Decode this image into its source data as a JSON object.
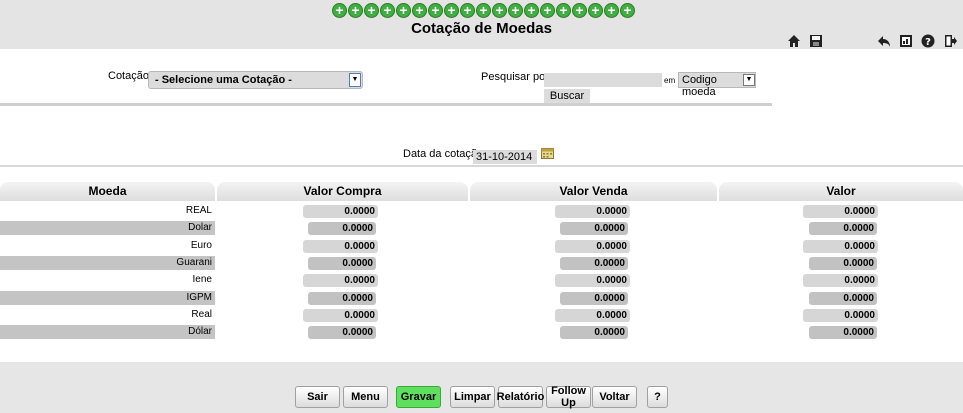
{
  "header": {
    "title": "Cotação de Moedas",
    "plus_count": 19
  },
  "filters": {
    "cotacao_label": "Cotação",
    "cotacao_value": "- Selecione uma Cotação -",
    "search_label": "Pesquisar por:",
    "em_label": "em",
    "search_field_value": "Codigo moeda",
    "buscar_label": "Buscar",
    "date_label": "Data da cotação",
    "date_value": "31-10-2014"
  },
  "table": {
    "headers": [
      "Moeda",
      "Valor Compra",
      "Valor Venda",
      "Valor"
    ],
    "rows": [
      {
        "moeda": "REAL",
        "compra": "0.0000",
        "venda": "0.0000",
        "valor": "0.0000"
      },
      {
        "moeda": "Dolar",
        "compra": "0.0000",
        "venda": "0.0000",
        "valor": "0.0000"
      },
      {
        "moeda": "Euro",
        "compra": "0.0000",
        "venda": "0.0000",
        "valor": "0.0000"
      },
      {
        "moeda": "Guarani",
        "compra": "0.0000",
        "venda": "0.0000",
        "valor": "0.0000"
      },
      {
        "moeda": "Iene",
        "compra": "0.0000",
        "venda": "0.0000",
        "valor": "0.0000"
      },
      {
        "moeda": "IGPM",
        "compra": "0.0000",
        "venda": "0.0000",
        "valor": "0.0000"
      },
      {
        "moeda": "Real",
        "compra": "0.0000",
        "venda": "0.0000",
        "valor": "0.0000"
      },
      {
        "moeda": "Dólar",
        "compra": "0.0000",
        "venda": "0.0000",
        "valor": "0.0000"
      }
    ]
  },
  "footer": {
    "sair": "Sair",
    "menu": "Menu",
    "gravar": "Gravar",
    "limpar": "Limpar",
    "relatorio": "Relatório",
    "followup": "Follow Up",
    "voltar": "Voltar",
    "help": "?"
  },
  "colors": {
    "accent_green": "#3fae3f",
    "gravar_green": "#5ee05e"
  }
}
